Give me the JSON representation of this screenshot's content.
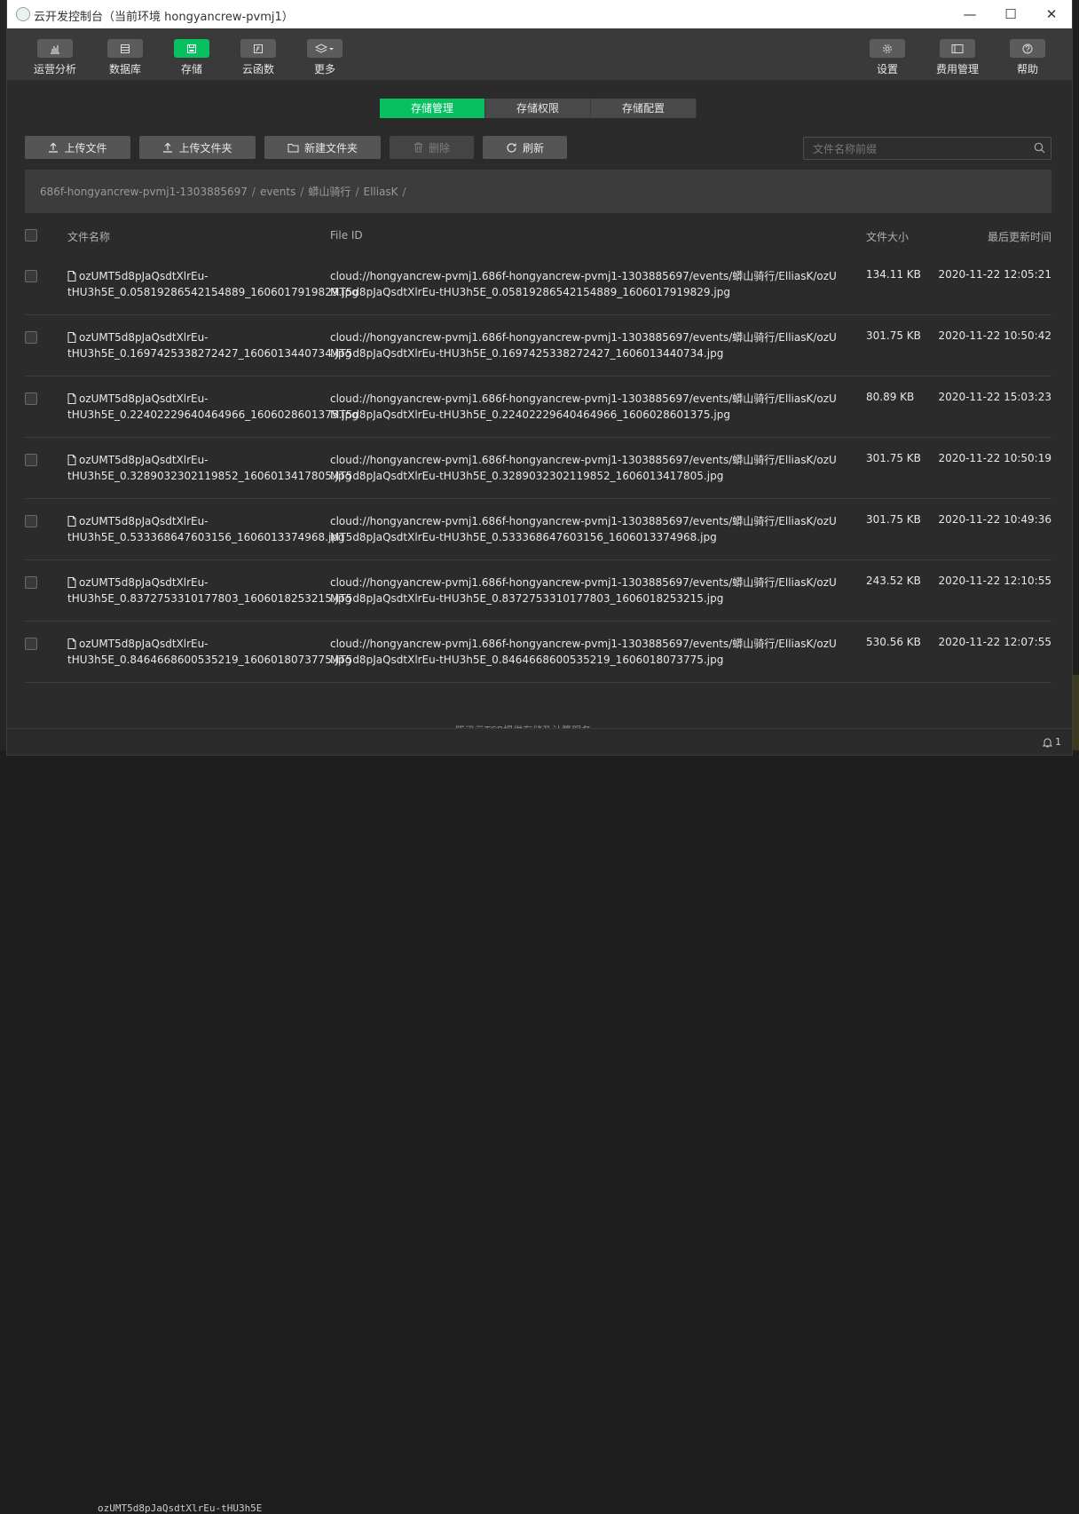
{
  "window": {
    "title": "云开发控制台（当前环境 hongyancrew-pvmj1）",
    "controls": {
      "minimize": "—",
      "maximize": "☐",
      "close": "✕"
    }
  },
  "toolbar": {
    "left": [
      {
        "label": "运营分析",
        "icon": "chart-icon"
      },
      {
        "label": "数据库",
        "icon": "database-icon"
      },
      {
        "label": "存储",
        "icon": "storage-icon",
        "active": true
      },
      {
        "label": "云函数",
        "icon": "function-icon"
      },
      {
        "label": "更多",
        "icon": "layers-icon"
      }
    ],
    "right": [
      {
        "label": "设置",
        "icon": "gear-icon"
      },
      {
        "label": "费用管理",
        "icon": "billing-icon"
      },
      {
        "label": "帮助",
        "icon": "help-icon"
      }
    ]
  },
  "tabs": [
    {
      "label": "存储管理",
      "active": true
    },
    {
      "label": "存储权限"
    },
    {
      "label": "存储配置"
    }
  ],
  "actions": {
    "upload_file": "上传文件",
    "upload_folder": "上传文件夹",
    "new_folder": "新建文件夹",
    "delete": "删除",
    "refresh": "刷新"
  },
  "search": {
    "placeholder": "文件名称前缀",
    "value": ""
  },
  "breadcrumb": [
    "686f-hongyancrew-pvmj1-1303885697",
    "events",
    "蟒山骑行",
    "ElliasK"
  ],
  "table": {
    "headers": {
      "name": "文件名称",
      "file_id": "File ID",
      "size": "文件大小",
      "updated": "最后更新时间"
    },
    "rows": [
      {
        "name": "ozUMT5d8pJaQsdtXlrEu-tHU3h5E_0.05819286542154889_1606017919829.jpg",
        "file_id": "cloud://hongyancrew-pvmj1.686f-hongyancrew-pvmj1-1303885697/events/蟒山骑行/ElliasK/ozUMT5d8pJaQsdtXlrEu-tHU3h5E_0.05819286542154889_1606017919829.jpg",
        "size": "134.11 KB",
        "updated": "2020-11-22 12:05:21"
      },
      {
        "name": "ozUMT5d8pJaQsdtXlrEu-tHU3h5E_0.1697425338272427_1606013440734.jpg",
        "file_id": "cloud://hongyancrew-pvmj1.686f-hongyancrew-pvmj1-1303885697/events/蟒山骑行/ElliasK/ozUMT5d8pJaQsdtXlrEu-tHU3h5E_0.1697425338272427_1606013440734.jpg",
        "size": "301.75 KB",
        "updated": "2020-11-22 10:50:42"
      },
      {
        "name": "ozUMT5d8pJaQsdtXlrEu-tHU3h5E_0.22402229640464966_1606028601375.jpg",
        "file_id": "cloud://hongyancrew-pvmj1.686f-hongyancrew-pvmj1-1303885697/events/蟒山骑行/ElliasK/ozUMT5d8pJaQsdtXlrEu-tHU3h5E_0.22402229640464966_1606028601375.jpg",
        "size": "80.89 KB",
        "updated": "2020-11-22 15:03:23"
      },
      {
        "name": "ozUMT5d8pJaQsdtXlrEu-tHU3h5E_0.3289032302119852_1606013417805.jpg",
        "file_id": "cloud://hongyancrew-pvmj1.686f-hongyancrew-pvmj1-1303885697/events/蟒山骑行/ElliasK/ozUMT5d8pJaQsdtXlrEu-tHU3h5E_0.3289032302119852_1606013417805.jpg",
        "size": "301.75 KB",
        "updated": "2020-11-22 10:50:19"
      },
      {
        "name": "ozUMT5d8pJaQsdtXlrEu-tHU3h5E_0.533368647603156_1606013374968.jpg",
        "file_id": "cloud://hongyancrew-pvmj1.686f-hongyancrew-pvmj1-1303885697/events/蟒山骑行/ElliasK/ozUMT5d8pJaQsdtXlrEu-tHU3h5E_0.533368647603156_1606013374968.jpg",
        "size": "301.75 KB",
        "updated": "2020-11-22 10:49:36"
      },
      {
        "name": "ozUMT5d8pJaQsdtXlrEu-tHU3h5E_0.8372753310177803_1606018253215.jpg",
        "file_id": "cloud://hongyancrew-pvmj1.686f-hongyancrew-pvmj1-1303885697/events/蟒山骑行/ElliasK/ozUMT5d8pJaQsdtXlrEu-tHU3h5E_0.8372753310177803_1606018253215.jpg",
        "size": "243.52 KB",
        "updated": "2020-11-22 12:10:55"
      },
      {
        "name": "ozUMT5d8pJaQsdtXlrEu-tHU3h5E_0.8464668600535219_1606018073775.jpg",
        "file_id": "cloud://hongyancrew-pvmj1.686f-hongyancrew-pvmj1-1303885697/events/蟒山骑行/ElliasK/ozUMT5d8pJaQsdtXlrEu-tHU3h5E_0.8464668600535219_1606018073775.jpg",
        "size": "530.56 KB",
        "updated": "2020-11-22 12:07:55"
      }
    ]
  },
  "footer_note": "腾讯云TCB提供存储及计算服务",
  "status": {
    "notifications": "1"
  },
  "background": {
    "editor_line": "ozUMT5d8pJaQsdtXlrEu-tHU3h5E"
  },
  "colors": {
    "accent": "#07c160",
    "panel": "#2b2b2b",
    "toolbar": "#3a3a3a"
  }
}
